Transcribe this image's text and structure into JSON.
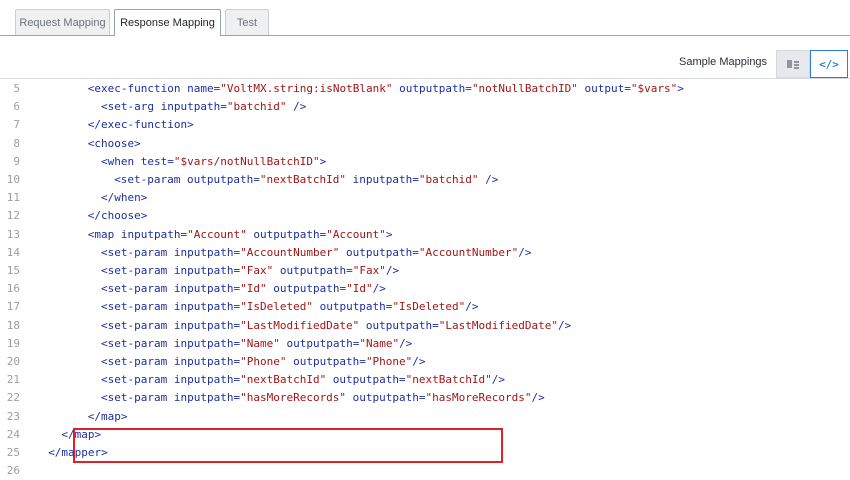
{
  "tabs": [
    {
      "label": "Request Mapping",
      "active": false
    },
    {
      "label": "Response Mapping",
      "active": true
    },
    {
      "label": "Test",
      "active": false
    }
  ],
  "toolbar": {
    "sample_mappings_label": "Sample Mappings",
    "code_view_glyph": "</>"
  },
  "colors": {
    "tag": "#1b2fa1",
    "attribute_value": "#a31515",
    "line_number": "#9aa0a6",
    "highlight_border": "#e0202a",
    "active_view_accent": "#2a7fd4"
  },
  "highlighted_lines": [
    21,
    22
  ],
  "code_lines": [
    {
      "num": "5",
      "indent": 8,
      "segments": [
        [
          "tag",
          "<exec-function "
        ],
        [
          "attr",
          "name="
        ],
        [
          "val",
          "\"VoltMX.string:isNotBlank\""
        ],
        [
          "attr",
          " outputpath="
        ],
        [
          "val",
          "\"notNullBatchID\""
        ],
        [
          "attr",
          " output="
        ],
        [
          "val",
          "\"$vars\""
        ],
        [
          "tag",
          ">"
        ]
      ]
    },
    {
      "num": "6",
      "indent": 10,
      "segments": [
        [
          "tag",
          "<set-arg "
        ],
        [
          "attr",
          "inputpath="
        ],
        [
          "val",
          "\"batchid\""
        ],
        [
          "tag",
          " />"
        ]
      ]
    },
    {
      "num": "7",
      "indent": 8,
      "segments": [
        [
          "tag",
          "</exec-function>"
        ]
      ]
    },
    {
      "num": "8",
      "indent": 8,
      "segments": [
        [
          "tag",
          "<choose>"
        ]
      ]
    },
    {
      "num": "9",
      "indent": 10,
      "segments": [
        [
          "tag",
          "<when "
        ],
        [
          "attr",
          "test="
        ],
        [
          "val",
          "\"$vars/notNullBatchID\""
        ],
        [
          "tag",
          ">"
        ]
      ]
    },
    {
      "num": "10",
      "indent": 12,
      "segments": [
        [
          "tag",
          "<set-param "
        ],
        [
          "attr",
          "outputpath="
        ],
        [
          "val",
          "\"nextBatchId\""
        ],
        [
          "attr",
          " inputpath="
        ],
        [
          "val",
          "\"batchid\""
        ],
        [
          "tag",
          " />"
        ]
      ]
    },
    {
      "num": "11",
      "indent": 10,
      "segments": [
        [
          "tag",
          "</when>"
        ]
      ]
    },
    {
      "num": "12",
      "indent": 8,
      "segments": [
        [
          "tag",
          "</choose>"
        ]
      ]
    },
    {
      "num": "13",
      "indent": 8,
      "segments": [
        [
          "tag",
          "<map "
        ],
        [
          "attr",
          "inputpath="
        ],
        [
          "val",
          "\"Account\""
        ],
        [
          "attr",
          " outputpath="
        ],
        [
          "val",
          "\"Account\""
        ],
        [
          "tag",
          ">"
        ]
      ]
    },
    {
      "num": "14",
      "indent": 10,
      "segments": [
        [
          "tag",
          "<set-param "
        ],
        [
          "attr",
          "inputpath="
        ],
        [
          "val",
          "\"AccountNumber\""
        ],
        [
          "attr",
          " outputpath="
        ],
        [
          "val",
          "\"AccountNumber\""
        ],
        [
          "tag",
          "/>"
        ]
      ]
    },
    {
      "num": "15",
      "indent": 10,
      "segments": [
        [
          "tag",
          "<set-param "
        ],
        [
          "attr",
          "inputpath="
        ],
        [
          "val",
          "\"Fax\""
        ],
        [
          "attr",
          " outputpath="
        ],
        [
          "val",
          "\"Fax\""
        ],
        [
          "tag",
          "/>"
        ]
      ]
    },
    {
      "num": "16",
      "indent": 10,
      "segments": [
        [
          "tag",
          "<set-param "
        ],
        [
          "attr",
          "inputpath="
        ],
        [
          "val",
          "\"Id\""
        ],
        [
          "attr",
          " outputpath="
        ],
        [
          "val",
          "\"Id\""
        ],
        [
          "tag",
          "/>"
        ]
      ]
    },
    {
      "num": "17",
      "indent": 10,
      "segments": [
        [
          "tag",
          "<set-param "
        ],
        [
          "attr",
          "inputpath="
        ],
        [
          "val",
          "\"IsDeleted\""
        ],
        [
          "attr",
          " outputpath="
        ],
        [
          "val",
          "\"IsDeleted\""
        ],
        [
          "tag",
          "/>"
        ]
      ]
    },
    {
      "num": "18",
      "indent": 10,
      "segments": [
        [
          "tag",
          "<set-param "
        ],
        [
          "attr",
          "inputpath="
        ],
        [
          "val",
          "\"LastModifiedDate\""
        ],
        [
          "attr",
          " outputpath="
        ],
        [
          "val",
          "\"LastModifiedDate\""
        ],
        [
          "tag",
          "/>"
        ]
      ]
    },
    {
      "num": "19",
      "indent": 10,
      "segments": [
        [
          "tag",
          "<set-param "
        ],
        [
          "attr",
          "inputpath="
        ],
        [
          "val",
          "\"Name\""
        ],
        [
          "attr",
          " outputpath="
        ],
        [
          "val",
          "\"Name\""
        ],
        [
          "tag",
          "/>"
        ]
      ]
    },
    {
      "num": "20",
      "indent": 10,
      "segments": [
        [
          "tag",
          "<set-param "
        ],
        [
          "attr",
          "inputpath="
        ],
        [
          "val",
          "\"Phone\""
        ],
        [
          "attr",
          " outputpath="
        ],
        [
          "val",
          "\"Phone\""
        ],
        [
          "tag",
          "/>"
        ]
      ]
    },
    {
      "num": "21",
      "indent": 10,
      "segments": [
        [
          "tag",
          "<set-param "
        ],
        [
          "attr",
          "inputpath="
        ],
        [
          "val",
          "\"nextBatchId\""
        ],
        [
          "attr",
          " outputpath="
        ],
        [
          "val",
          "\"nextBatchId\""
        ],
        [
          "tag",
          "/>"
        ]
      ]
    },
    {
      "num": "22",
      "indent": 10,
      "segments": [
        [
          "tag",
          "<set-param "
        ],
        [
          "attr",
          "inputpath="
        ],
        [
          "val",
          "\"hasMoreRecords\""
        ],
        [
          "attr",
          " outputpath="
        ],
        [
          "val",
          "\"hasMoreRecords\""
        ],
        [
          "tag",
          "/>"
        ]
      ]
    },
    {
      "num": "23",
      "indent": 8,
      "segments": [
        [
          "tag",
          "</map>"
        ]
      ]
    },
    {
      "num": "24",
      "indent": 4,
      "segments": [
        [
          "tag",
          "</map>"
        ]
      ]
    },
    {
      "num": "25",
      "indent": 2,
      "segments": [
        [
          "tag",
          "</mapper>"
        ]
      ]
    },
    {
      "num": "26",
      "indent": 0,
      "segments": []
    }
  ]
}
